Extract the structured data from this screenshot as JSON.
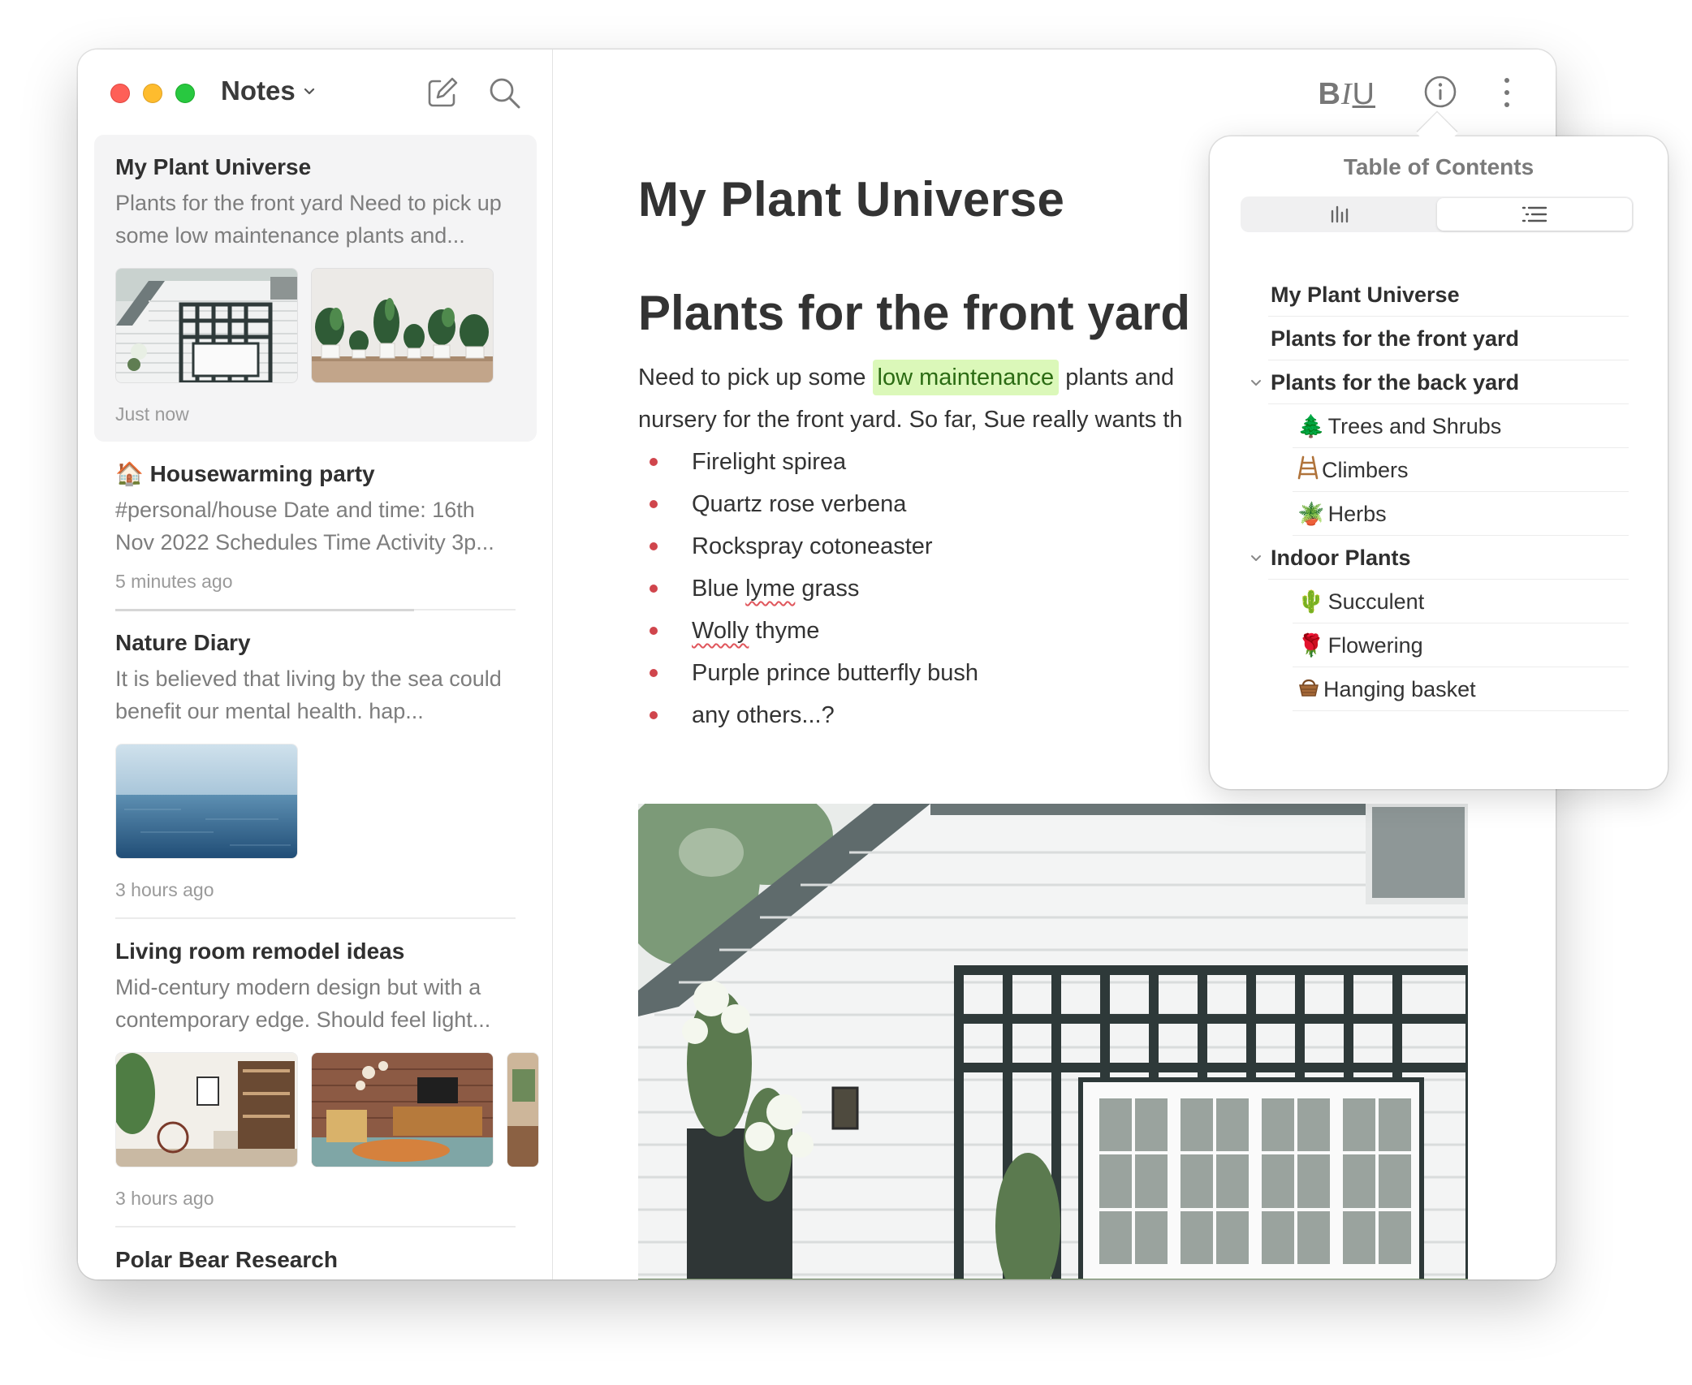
{
  "app": {
    "sidebar_title": "Notes"
  },
  "notes": [
    {
      "title": "My Plant Universe",
      "snippet": "Plants for the front yard Need to pick up some low maintenance plants and...",
      "time": "Just now"
    },
    {
      "emoji": "🏠",
      "title": "Housewarming party",
      "snippet": "#personal/house Date and time: 16th Nov 2022 Schedules Time Activity 3p...",
      "time": "5 minutes ago"
    },
    {
      "title": "Nature Diary",
      "snippet": "It is believed that living by the sea could benefit our mental health. hap...",
      "time": "3 hours ago"
    },
    {
      "title": "Living room remodel ideas",
      "snippet": "Mid-century modern design but with a contemporary edge. Should feel light...",
      "time": "3 hours ago"
    },
    {
      "title": "Polar Bear Research"
    }
  ],
  "toolbar": {
    "bold": "B",
    "italic": "I",
    "underline": "U"
  },
  "doc": {
    "title": "My Plant Universe",
    "heading": "Plants for the front yard",
    "para_before": "Need to pick up some ",
    "para_highlight": "low maintenance",
    "para_after": " plants and",
    "para_line2": "nursery for the front yard. So far, Sue really wants th",
    "bullets": [
      "Firelight spirea",
      "Quartz rose verbena",
      "Rockspray cotoneaster",
      "Blue lyme grass",
      "Wolly thyme",
      "Purple prince butterfly bush",
      "any others...?"
    ],
    "bullet_parts": {
      "blue_pre": "Blue ",
      "blue_word": "lyme",
      "blue_post": " grass",
      "wolly_word": "Wolly",
      "wolly_post": " thyme"
    }
  },
  "toc": {
    "title": "Table of Contents",
    "items": [
      {
        "label": "My Plant Universe",
        "level": 1
      },
      {
        "label": "Plants for the front yard",
        "level": 1
      },
      {
        "label": "Plants for the back yard",
        "level": 1,
        "expanded": true
      },
      {
        "label": "Trees and Shrubs",
        "level": 2,
        "icon": "🌲"
      },
      {
        "label": "Climbers",
        "level": 2,
        "icon": "🪜"
      },
      {
        "label": "Herbs",
        "level": 2,
        "icon": "🪴"
      },
      {
        "label": "Indoor Plants",
        "level": 1,
        "expanded": true
      },
      {
        "label": "Succulent",
        "level": 2,
        "icon": "🌵"
      },
      {
        "label": "Flowering",
        "level": 2,
        "icon": "🌹"
      },
      {
        "label": "Hanging basket",
        "level": 2,
        "icon": "🧺"
      }
    ]
  },
  "colors": {
    "accent_highlight": "#dbf8b9",
    "bullet": "#d0454c",
    "traffic_red": "#fe5f57",
    "traffic_yellow": "#febc2e",
    "traffic_green": "#28c840"
  }
}
